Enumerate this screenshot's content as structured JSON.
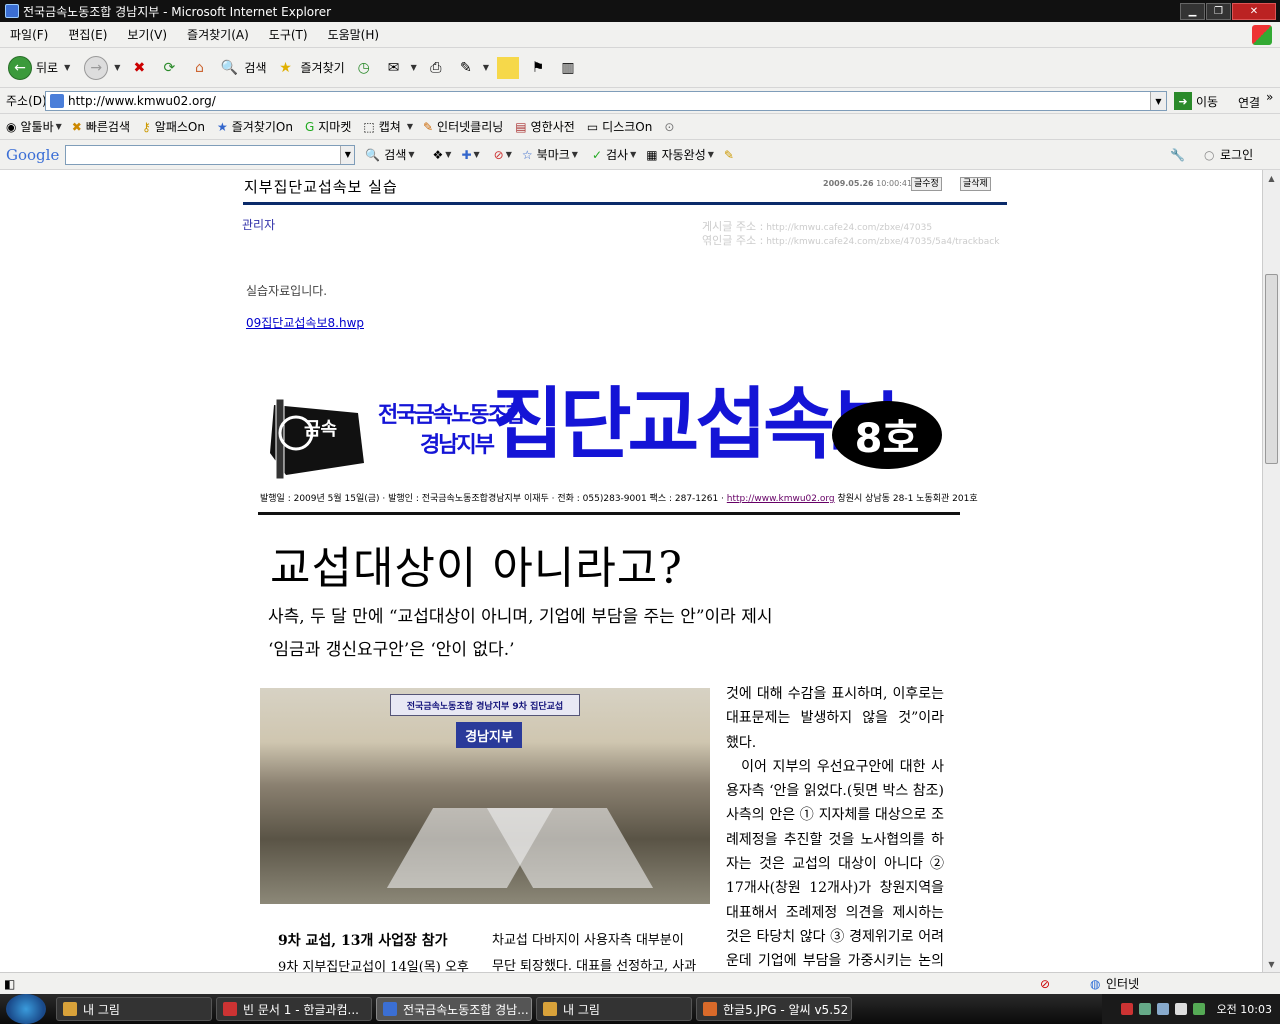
{
  "window": {
    "title": "전국금속노동조합 경남지부 - Microsoft Internet Explorer"
  },
  "menu": [
    "파일(F)",
    "편집(E)",
    "보기(V)",
    "즐겨찾기(A)",
    "도구(T)",
    "도움말(H)"
  ],
  "toolbar": {
    "back": "뒤로",
    "search": "검색",
    "favorites": "즐겨찾기"
  },
  "address": {
    "label": "주소(D)",
    "url": "http://www.kmwu02.org/",
    "go": "이동",
    "links": "연결"
  },
  "linksbar": [
    "알툴바",
    "빠른검색",
    "알패스On",
    "즐겨찾기On",
    "지마켓",
    "캡쳐",
    "인터넷클리닝",
    "영한사전",
    "디스크On"
  ],
  "googlebar": {
    "logo": "Google",
    "search": "검색",
    "bookmarks": "북마크",
    "spell": "검사",
    "autofill": "자동완성",
    "login": "로그인"
  },
  "post": {
    "title": "지부집단교섭속보 실습",
    "date": "2009.05.26",
    "time": "10:00:41",
    "btn_edit": "글수정",
    "btn_delete": "글삭제",
    "author": "관리자",
    "addr_label": "게시글 주소 :",
    "addr_url": "http://kmwu.cafe24.com/zbxe/47035",
    "trackback_label": "엮인글 주소 :",
    "trackback_url": "http://kmwu.cafe24.com/zbxe/47035/5a4/trackback",
    "body": "실습자료입니다.",
    "attachment": "09집단교섭속보8.hwp"
  },
  "newsletter": {
    "logo_text": "금속",
    "org_line1": "전국금속노동조합",
    "org_line2": "경남지부",
    "title": "집단교섭속보",
    "issue": "8호",
    "pubinfo": "발행일 : 2009년 5월 15일(금) · 발행인 : 전국금속노동조합경남지부 이재두 · 전화 : 055)283-9001 팩스 : 287-1261 · ",
    "publink": "http://www.kmwu02.org",
    "pubaddr": " 창원시 상남동 28-1 노동회관 201호",
    "headline": "교섭대상이 아니라고?",
    "sub1": "사측, 두 달 만에 “교섭대상이 아니며, 기업에 부담을 주는 안”이라 제시",
    "sub2": "‘임금과 갱신요구안’은 ‘안이 없다.’",
    "photo_banner": "전국금속노동조합 경남지부 9차 집단교섭",
    "photo_banner2": "경남지부",
    "col_right": "것에 대해 수감을 표시하며, 이후로는 대표문제는 발생하지 않을 것”이라 했다.\n　이어 지부의 우선요구안에 대한 사용자측 ‘안을 읽었다.(뒷면 박스 참조) 사측의 안은 ① 지자체를 대상으로 조례제정을 추진할 것을 노사협의를 하자는 것은 교섭의 대상이 아니다 ② 17개사(창원 12개사)가 창원지역을 대표해서 조례제정 의견을 제시하는 것은 타당치 않다 ③ 경제위기로 어려운데 기업에 부담을 가중시키는 논의는",
    "section_head": "9차 교섭, 13개 사업장 참가",
    "section_text": "9차 지부집단교섭이 14일(목) 오후",
    "col2_line1": "차교섭 다바지이 사용자측 대부분이",
    "col2_line2": "무단 퇴장했다. 대표를 선정하고, 사과"
  },
  "status": {
    "zone": "인터넷"
  },
  "taskbar": {
    "items": [
      "내 그림",
      "빈 문서 1 - 한글과컴...",
      "전국금속노동조합 경남...",
      "내 그림",
      "한글5.JPG - 알씨 v5.52"
    ],
    "clock": "오전 10:03"
  }
}
